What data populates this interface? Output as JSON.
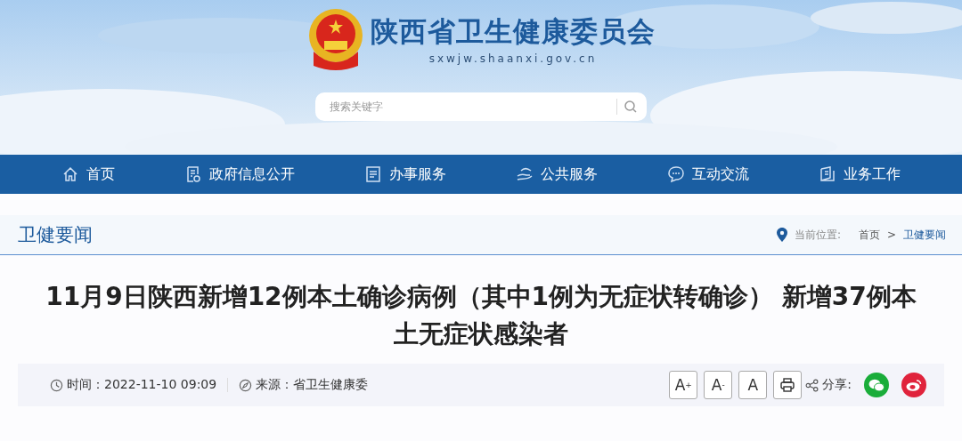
{
  "header": {
    "site_name": "陕西省卫生健康委员会",
    "domain": "sxwjw.shaanxi.gov.cn",
    "search": {
      "placeholder": "搜索关键字"
    }
  },
  "nav": [
    {
      "label": "首页"
    },
    {
      "label": "政府信息公开"
    },
    {
      "label": "办事服务"
    },
    {
      "label": "公共服务"
    },
    {
      "label": "互动交流"
    },
    {
      "label": "业务工作"
    }
  ],
  "section": {
    "title": "卫健要闻",
    "location_label": "当前位置:",
    "breadcrumb": [
      {
        "label": "首页",
        "current": false
      },
      {
        "label": ">",
        "current": false
      },
      {
        "label": "卫健要闻",
        "current": true
      }
    ]
  },
  "article": {
    "title": "11月9日陕西新增12例本土确诊病例（其中1例为无症状转确诊） 新增37例本土无症状感染者",
    "time": "时间：2022-11-10 09:09",
    "source": "来源：省卫生健康委",
    "font_buttons": [
      "A$^{+}$",
      "A$^{-}$",
      "A"
    ],
    "share_label": "分享:"
  }
}
